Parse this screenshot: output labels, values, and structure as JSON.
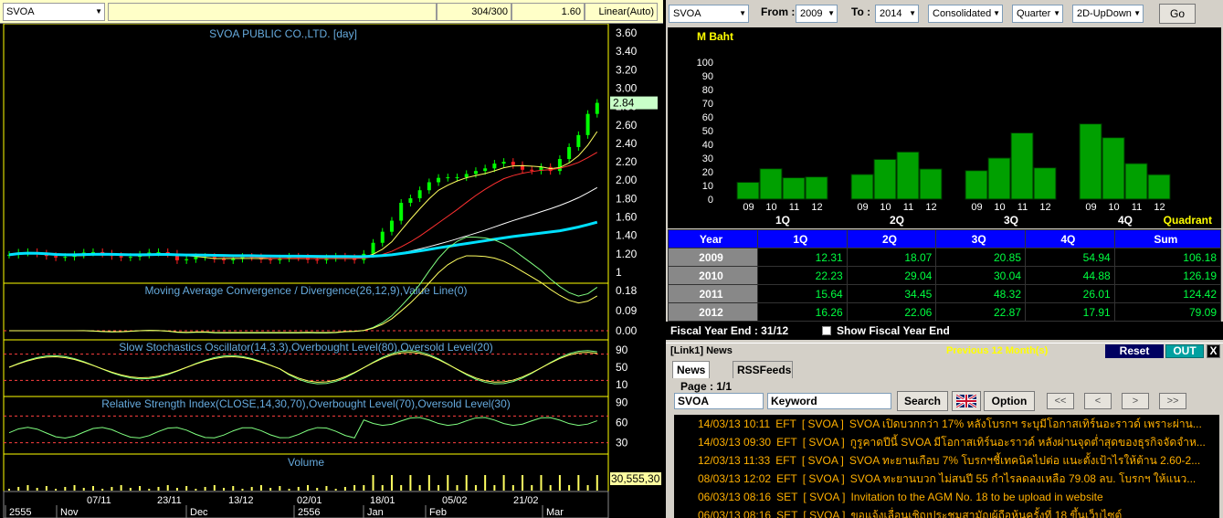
{
  "chart_panel": {
    "symbol": "SVOA",
    "counter": "304/300",
    "last": "1.60",
    "scale": "Linear(Auto)",
    "title": "SVOA PUBLIC CO.,LTD. [day]",
    "price_axis": [
      "3.60",
      "3.40",
      "3.20",
      "3.00",
      "2.80",
      "2.60",
      "2.40",
      "2.20",
      "2.00",
      "1.80",
      "1.60",
      "1.40",
      "1.20",
      "1"
    ],
    "last_price_tag": "2.84",
    "macd": {
      "title": "Moving Average Convergence / Divergence(26,12,9),Value Line(0)",
      "axis": [
        "0.18",
        "0.09",
        "0.00"
      ]
    },
    "stoch": {
      "title": "Slow Stochastics Oscillator(14,3,3),Overbought Level(80),Oversold Level(20)",
      "axis": [
        "90",
        "50",
        "10"
      ]
    },
    "rsi": {
      "title": "Relative Strength Index(CLOSE,14,30,70),Overbought Level(70),Oversold Level(30)",
      "axis": [
        "90",
        "60",
        "30"
      ]
    },
    "volume": {
      "title": "Volume",
      "tag": "30,555,30"
    },
    "date_ticks": [
      "07/11",
      "23/11",
      "13/12",
      "02/01",
      "18/01",
      "05/02",
      "21/02"
    ],
    "month_labels": [
      "2555",
      "Nov",
      "Dec",
      "2556",
      "Jan",
      "Feb",
      "Mar"
    ]
  },
  "query_bar": {
    "symbol": "SVOA",
    "from_label": "From :",
    "from_value": "2009",
    "to_label": "To :",
    "to_value": "2014",
    "statement": "Consolidated",
    "period": "Quarter",
    "chart_mode": "2D-UpDown",
    "go_label": "Go"
  },
  "chart_data": {
    "type": "bar",
    "unit_label": "M Baht",
    "axis_label": "Quadrant",
    "ylim": [
      0,
      100
    ],
    "yticks": [
      0,
      10,
      20,
      30,
      40,
      50,
      60,
      70,
      80,
      90,
      100
    ],
    "groups": [
      {
        "label": "1Q",
        "categories": [
          "09",
          "10",
          "11",
          "12"
        ],
        "values": [
          12.31,
          22.23,
          15.64,
          16.26
        ]
      },
      {
        "label": "2Q",
        "categories": [
          "09",
          "10",
          "11",
          "12"
        ],
        "values": [
          18.07,
          29.04,
          34.45,
          22.06
        ]
      },
      {
        "label": "3Q",
        "categories": [
          "09",
          "10",
          "11",
          "12"
        ],
        "values": [
          20.85,
          30.04,
          48.32,
          22.87
        ]
      },
      {
        "label": "4Q",
        "categories": [
          "09",
          "10",
          "11",
          "12"
        ],
        "values": [
          54.94,
          44.88,
          26.01,
          17.91
        ]
      }
    ],
    "colors": {
      "bar": "#00a000",
      "background": "#000000",
      "axis_text": "#ffffff",
      "title_text": "#ffff00"
    }
  },
  "table": {
    "headers": [
      "Year",
      "1Q",
      "2Q",
      "3Q",
      "4Q",
      "Sum"
    ],
    "rows": [
      [
        "2009",
        "12.31",
        "18.07",
        "20.85",
        "54.94",
        "106.18"
      ],
      [
        "2010",
        "22.23",
        "29.04",
        "30.04",
        "44.88",
        "126.19"
      ],
      [
        "2011",
        "15.64",
        "34.45",
        "48.32",
        "26.01",
        "124.42"
      ],
      [
        "2012",
        "16.26",
        "22.06",
        "22.87",
        "17.91",
        "79.09"
      ]
    ]
  },
  "fiscal": {
    "label": "Fiscal Year End : 31/12",
    "checkbox_label": "Show Fiscal Year End"
  },
  "news": {
    "title": "[Link1] News",
    "period_label": "Previous 12 Month(s)",
    "reset_label": "Reset",
    "out_label": "OUT",
    "close_label": "X",
    "tabs": [
      "News (0)",
      "RSSFeeds"
    ],
    "page_label": "Page : 1/1",
    "symbol_input": "SVOA",
    "keyword_placeholder": "Keyword",
    "search_label": "Search",
    "option_label": "Option",
    "nav": [
      "<<",
      "<",
      ">",
      ">>"
    ],
    "items": [
      {
        "time": "14/03/13 10:11",
        "src": "EFT",
        "sym": "[ SVOA ]",
        "text": "SVOA เปิดบวกกว่า 17% หลังโบรกฯ ระบุมีโอกาสเทิร์นอะราวด์ เพราะผ่าน..."
      },
      {
        "time": "14/03/13 09:30",
        "src": "EFT",
        "sym": "[ SVOA ]",
        "text": "กูรูคาดปีนี้ SVOA มีโอกาสเทิร์นอะราวด์ หลังผ่านจุดต่ำสุดของธุรกิจจัดจำห..."
      },
      {
        "time": "12/03/13 11:33",
        "src": "EFT",
        "sym": "[ SVOA ]",
        "text": "SVOA ทะยานเกือบ 7% โบรกฯชี้เทคนิคไปต่อ แนะตั้งเป้าไรให้ต้าน 2.60-2..."
      },
      {
        "time": "08/03/13 12:02",
        "src": "EFT",
        "sym": "[ SVOA ]",
        "text": "SVOA ทะยานบวก ไม่สนปี 55 กำไรลดลงเหลือ 79.08 ลบ. โบรกฯ ให้แนว..."
      },
      {
        "time": "06/03/13 08:16",
        "src": "SET",
        "sym": "[ SVOA ]",
        "text": "Invitation to the AGM No. 18 to be upload in website"
      },
      {
        "time": "06/03/13 08:16",
        "src": "SET",
        "sym": "[ SVOA ]",
        "text": "ขอแจ้งเลื่อนเชิญประชุมสามัญผู้ถือหุ้นครั้งที่ 18 ขึ้นเว็บไซต์"
      }
    ]
  }
}
